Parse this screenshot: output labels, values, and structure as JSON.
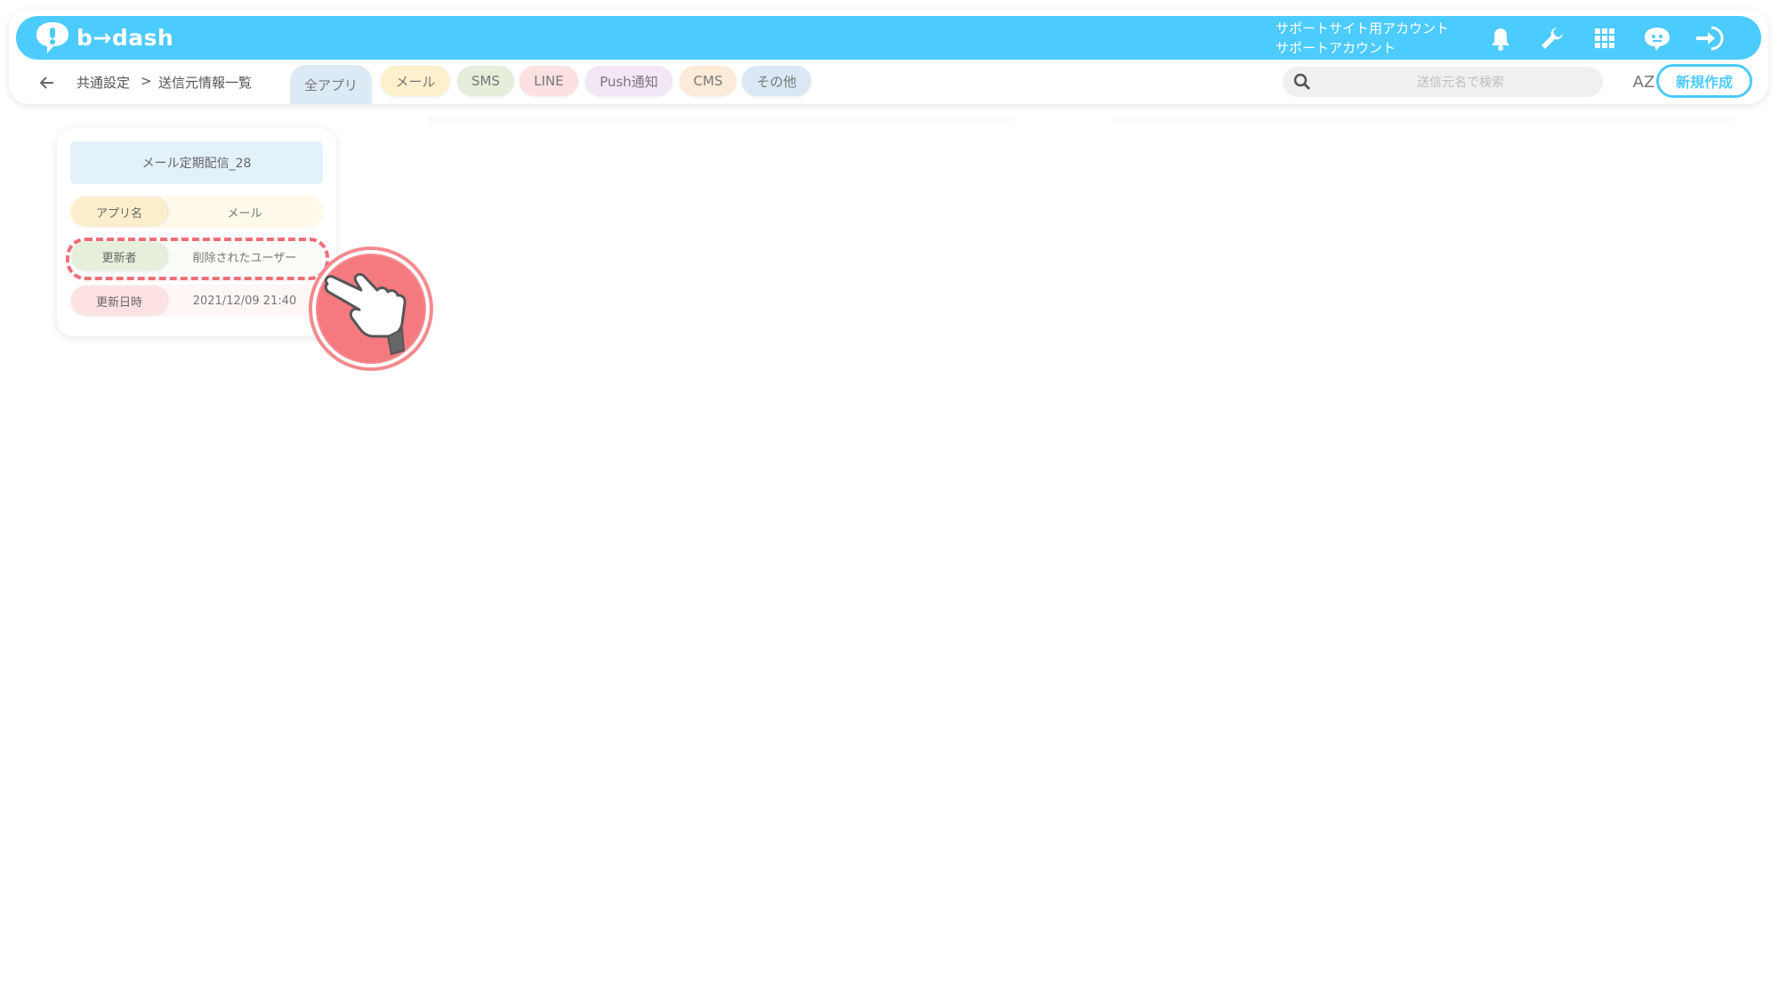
{
  "brand": {
    "name": "b→dash",
    "color": "#4ccbff"
  },
  "header": {
    "account_line1": "サポートサイト用アカウント",
    "account_line2": "サポートアカウント",
    "icons": [
      "bell-icon",
      "wrench-icon",
      "apps-grid-icon",
      "chat-bot-icon",
      "logout-icon"
    ]
  },
  "breadcrumb": {
    "back_icon": "arrow-left-icon",
    "parent": "共通設定",
    "separator": ">",
    "current": "送信元情報一覧"
  },
  "tabs": [
    {
      "label": "全アプリ",
      "active": true,
      "color": "#dceaf6"
    },
    {
      "label": "メール",
      "active": false,
      "color": "#fdf0cc"
    },
    {
      "label": "SMS",
      "active": false,
      "color": "#e4eedb"
    },
    {
      "label": "LINE",
      "active": false,
      "color": "#fde0e0"
    },
    {
      "label": "Push通知",
      "active": false,
      "color": "#f3e6f7"
    },
    {
      "label": "CMS",
      "active": false,
      "color": "#fdebd9"
    },
    {
      "label": "その他",
      "active": false,
      "color": "#d9e8f4"
    }
  ],
  "search": {
    "placeholder": "送信元名で検索",
    "icon": "search-icon"
  },
  "sort": {
    "label": "AZ",
    "icon": "sort-az-icon"
  },
  "new_button": {
    "label": "新規作成"
  },
  "card": {
    "title": "メール定期配信_28",
    "rows": [
      {
        "label": "アプリ名",
        "value": "メール",
        "label_color": "#fdeecb",
        "value_color": "#fffaeb"
      },
      {
        "label": "更新者",
        "value": "削除されたユーザー",
        "label_color": "#e6efdc",
        "value_color": "#fafcf7"
      },
      {
        "label": "更新日時",
        "value": "2021/12/09 21:40",
        "label_color": "#fde1e3",
        "value_color": "#fff6f6"
      }
    ]
  },
  "annotation": {
    "highlight_color": "#f06e78",
    "pointer_icon": "pointing-hand-icon"
  }
}
